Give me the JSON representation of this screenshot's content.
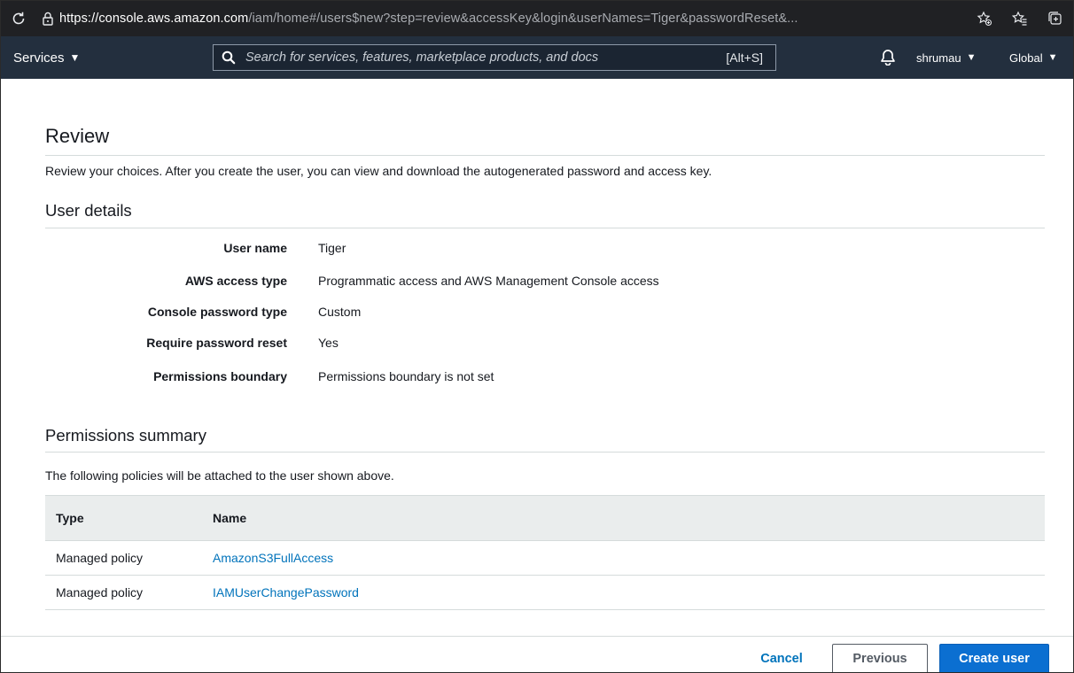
{
  "browser": {
    "url_host": "https://console.aws.amazon.com",
    "url_path": "/iam/home#/users$new?step=review&accessKey&login&userNames=Tiger&passwordReset&..."
  },
  "nav": {
    "services_label": "Services",
    "search_placeholder": "Search for services, features, marketplace products, and docs",
    "search_shortcut": "[Alt+S]",
    "username": "shrumau",
    "region": "Global"
  },
  "review": {
    "title": "Review",
    "intro": "Review your choices. After you create the user, you can view and download the autogenerated password and access key."
  },
  "user_details": {
    "title": "User details",
    "rows": [
      {
        "label": "User name",
        "value": "Tiger"
      },
      {
        "label": "AWS access type",
        "value": "Programmatic access and AWS Management Console access"
      },
      {
        "label": "Console password type",
        "value": "Custom"
      },
      {
        "label": "Require password reset",
        "value": "Yes"
      },
      {
        "label": "Permissions boundary",
        "value": "Permissions boundary is not set"
      }
    ]
  },
  "permissions": {
    "title": "Permissions summary",
    "intro": "The following policies will be attached to the user shown above.",
    "columns": {
      "type": "Type",
      "name": "Name"
    },
    "rows": [
      {
        "type": "Managed policy",
        "name": "AmazonS3FullAccess"
      },
      {
        "type": "Managed policy",
        "name": "IAMUserChangePassword"
      }
    ]
  },
  "actions": {
    "cancel": "Cancel",
    "previous": "Previous",
    "create": "Create user"
  },
  "colors": {
    "nav_bg": "#232f3e",
    "link": "#0073bb",
    "primary_button": "#0b6fd1"
  }
}
